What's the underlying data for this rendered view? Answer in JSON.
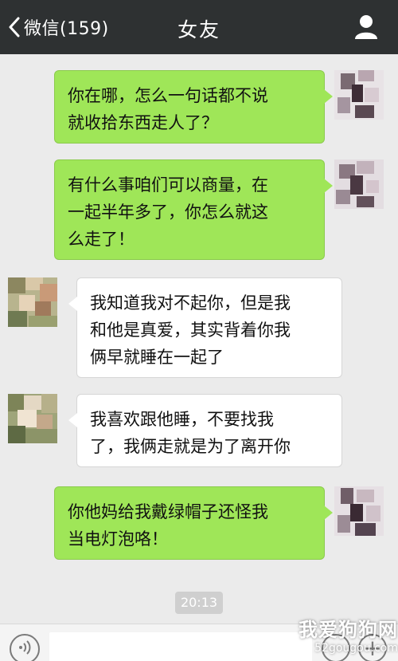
{
  "header": {
    "back_label": "微信(159)",
    "title": "女友",
    "icons": {
      "back": "chevron-left-icon",
      "contact": "person-icon"
    }
  },
  "colors": {
    "header_bg": "#2e3132",
    "chat_bg": "#ebebeb",
    "sent_bubble": "#9fe658",
    "received_bubble": "#ffffff"
  },
  "messages": [
    {
      "direction": "sent",
      "lines": [
        "你在哪，怎么一句话都不说",
        "就收拾东西走人了？"
      ]
    },
    {
      "direction": "sent",
      "lines": [
        "有什么事咱们可以商量，在",
        "一起半年多了，你怎么就这",
        "么走了！"
      ]
    },
    {
      "direction": "received",
      "lines": [
        "我知道我对不起你，但是我",
        "和他是真爱，其实背着你我",
        "俩早就睡在一起了"
      ]
    },
    {
      "direction": "received",
      "lines": [
        "我喜欢跟他睡，不要找我",
        "了，我俩走就是为了离开你"
      ]
    },
    {
      "direction": "sent",
      "lines": [
        "你他妈给我戴绿帽子还怪我",
        "当电灯泡咯！"
      ]
    }
  ],
  "timestamp": "20:13",
  "input_bar": {
    "icons": {
      "voice": "voice-icon",
      "emoji": "emoji-icon",
      "more": "plus-icon"
    }
  },
  "watermark": {
    "site_name": "我爱狗狗网",
    "url": "52gougou.com"
  }
}
